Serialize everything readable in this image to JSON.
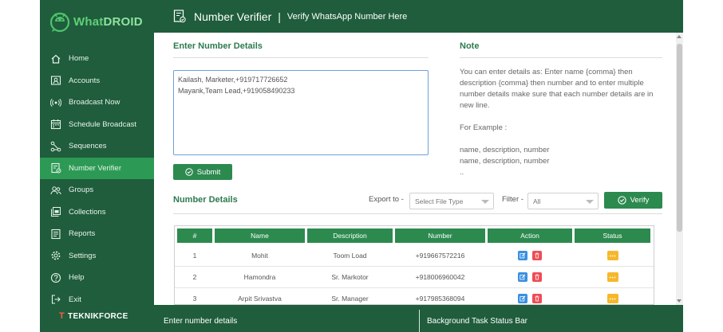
{
  "logo": {
    "text_a": "What",
    "text_b": "DROID"
  },
  "sidebar": {
    "items": [
      {
        "label": "Home",
        "icon": "home-icon"
      },
      {
        "label": "Accounts",
        "icon": "accounts-icon"
      },
      {
        "label": "Broadcast Now",
        "icon": "broadcast-icon"
      },
      {
        "label": "Schedule Broadcast",
        "icon": "calendar-icon"
      },
      {
        "label": "Sequences",
        "icon": "sequences-icon"
      },
      {
        "label": "Number Verifier",
        "icon": "verifier-icon",
        "active": true
      },
      {
        "label": "Groups",
        "icon": "groups-icon"
      },
      {
        "label": "Collections",
        "icon": "collections-icon"
      },
      {
        "label": "Reports",
        "icon": "reports-icon"
      },
      {
        "label": "Settings",
        "icon": "gear-icon"
      },
      {
        "label": "Help",
        "icon": "help-icon"
      },
      {
        "label": "Exit",
        "icon": "exit-icon"
      }
    ],
    "brand": {
      "t": "T",
      "text": "TEKNIKFORCE"
    }
  },
  "header": {
    "title": "Number Verifier",
    "separator": "|",
    "subtitle": "Verify WhatsApp Number Here"
  },
  "enter_details": {
    "title": "Enter Number Details",
    "textarea_value": "Kailash, Marketer,+919717726652\nMayank,Team Lead,+919058490233",
    "submit_label": "Submit"
  },
  "note": {
    "title": "Note",
    "text": "You can enter details as: Enter name {comma} then description {comma} then number and to enter multiple number details make sure that each number details are in new line.",
    "example_label": "For Example :",
    "example_lines": [
      "name, description, number",
      "name, description, number",
      ".."
    ]
  },
  "number_details": {
    "title": "Number Details",
    "export_label": "Export to -",
    "export_placeholder": "Select File Type",
    "filter_label": "Filter -",
    "filter_value": "All",
    "verify_label": "Verify"
  },
  "table": {
    "headers": [
      "#",
      "Name",
      "Description",
      "Number",
      "Action",
      "Status"
    ],
    "rows": [
      {
        "idx": "1",
        "name": "Mohit",
        "description": "Toom Load",
        "number": "+919667572216"
      },
      {
        "idx": "2",
        "name": "Hamondra",
        "description": "Sr. Markotor",
        "number": "+918006960042"
      },
      {
        "idx": "3",
        "name": "Arpit Srivastva",
        "description": "Sr. Manager",
        "number": "+917985368094"
      }
    ]
  },
  "statusbar": {
    "left": "Enter number details",
    "right": "Background Task Status Bar"
  },
  "colors": {
    "sidebar_bg": "#1f5d3c",
    "active_bg": "#2c9a55",
    "accent_green": "#2c8a4f",
    "edit_blue": "#3a8fe0",
    "delete_red": "#ee4d56",
    "status_yellow": "#f6b82a"
  }
}
